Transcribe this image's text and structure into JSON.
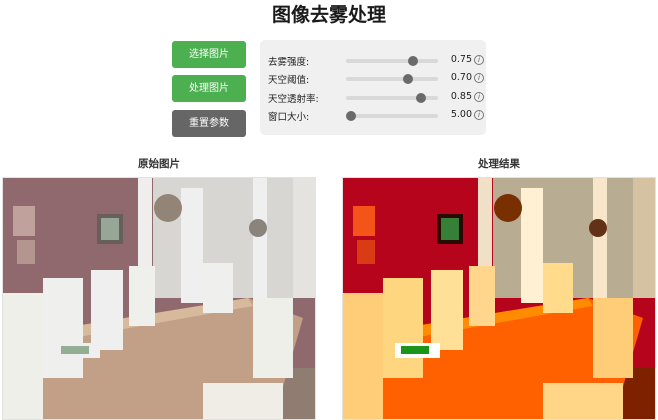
{
  "page_title": "图像去雾处理",
  "buttons": {
    "select": "选择图片",
    "process": "处理图片",
    "reset": "重置参数"
  },
  "params": [
    {
      "label": "去雾强度:",
      "value": "0.75",
      "level": 0.75
    },
    {
      "label": "天空阈值:",
      "value": "0.70",
      "level": 0.7
    },
    {
      "label": "天空透射率:",
      "value": "0.85",
      "level": 0.85
    },
    {
      "label": "窗口大小:",
      "value": "5.00",
      "level": 0.0
    }
  ],
  "info_glyph": "i",
  "panels": {
    "original_title": "原始图片",
    "result_title": "处理结果"
  },
  "icons": [
    "info-icon"
  ],
  "colors": {
    "primary_button": "#4caf50",
    "secondary_button": "#666666",
    "panel_background": "#f0f0f0"
  }
}
